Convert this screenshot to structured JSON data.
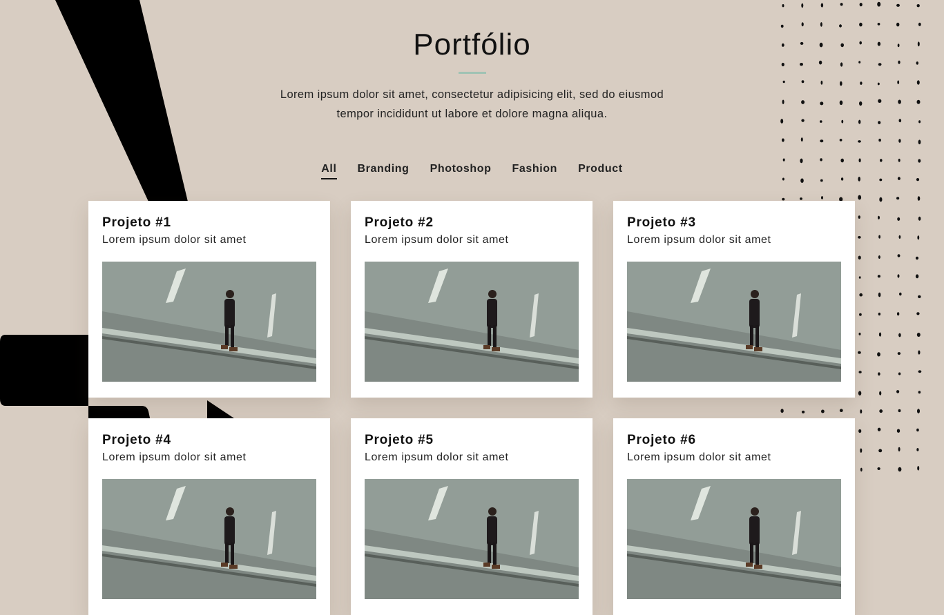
{
  "section": {
    "title": "Portfólio",
    "intro": "Lorem ipsum dolor sit amet, consectetur adipisicing elit, sed do eiusmod tempor incididunt ut labore et dolore magna aliqua."
  },
  "filters": [
    {
      "label": "All",
      "active": true
    },
    {
      "label": "Branding",
      "active": false
    },
    {
      "label": "Photoshop",
      "active": false
    },
    {
      "label": "Fashion",
      "active": false
    },
    {
      "label": "Product",
      "active": false
    }
  ],
  "projects": [
    {
      "title": "Projeto #1",
      "subtitle": "Lorem ipsum dolor sit amet",
      "image": "man-walking-photo"
    },
    {
      "title": "Projeto #2",
      "subtitle": "Lorem ipsum dolor sit amet",
      "image": "man-walking-photo"
    },
    {
      "title": "Projeto #3",
      "subtitle": "Lorem ipsum dolor sit amet",
      "image": "man-walking-photo"
    },
    {
      "title": "Projeto #4",
      "subtitle": "Lorem ipsum dolor sit amet",
      "image": "man-walking-photo"
    },
    {
      "title": "Projeto #5",
      "subtitle": "Lorem ipsum dolor sit amet",
      "image": "man-walking-photo"
    },
    {
      "title": "Projeto #6",
      "subtitle": "Lorem ipsum dolor sit amet",
      "image": "man-walking-photo"
    }
  ],
  "colors": {
    "background": "#d8cdc2",
    "accent": "#9fc3b4",
    "text": "#111111",
    "card": "#ffffff"
  }
}
